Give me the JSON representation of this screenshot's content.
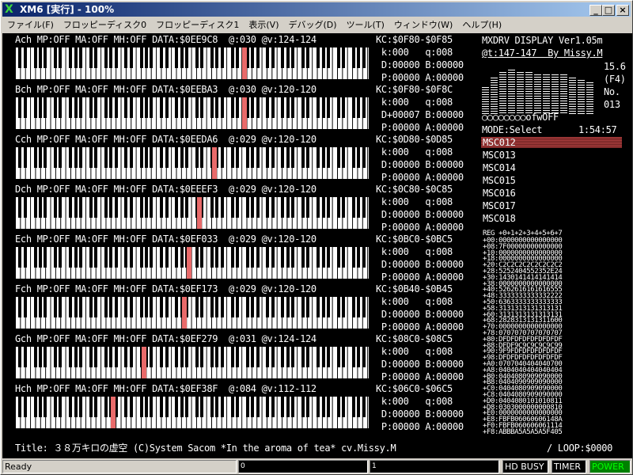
{
  "window": {
    "title": "XM6 [実行] - 100%",
    "app_icon": "X",
    "min": "_",
    "max": "□",
    "close": "×"
  },
  "menu": [
    "ファイル(F)",
    "フロッピーディスク0",
    "フロッピーディスク1",
    "表示(V)",
    "デバッグ(D)",
    "ツール(T)",
    "ウィンドウ(W)",
    "ヘルプ(H)"
  ],
  "channels": [
    {
      "header": "Ach MP:OFF MA:OFF MH:OFF DATA:$0EE9C8  @:030 @v:124-124",
      "kc": "KC:$0F80-$0F85",
      "kq": " k:000   q:008",
      "db": " D:00000 B:00000",
      "pa": " P:00000 A:00000",
      "hit_key": 45
    },
    {
      "header": "Bch MP:OFF MA:OFF MH:OFF DATA:$0EEBA3  @:030 @v:120-120",
      "kc": "KC:$0F80-$0F8C",
      "kq": " k:000   q:008",
      "db": " D+00007 B:00000",
      "pa": " P:00000 A:00000",
      "hit_key": 45
    },
    {
      "header": "Cch MP:OFF MA:OFF MH:OFF DATA:$0EEDA6  @:029 @v:120-120",
      "kc": "KC:$0D80-$0D85",
      "kq": " k:000   q:008",
      "db": " D:00000 B:00000",
      "pa": " P:00000 A:00000",
      "hit_key": 39
    },
    {
      "header": "Dch MP:OFF MA:OFF MH:OFF DATA:$0EEEF3  @:029 @v:120-120",
      "kc": "KC:$0C80-$0C85",
      "kq": " k:000   q:008",
      "db": " D:00000 B:00000",
      "pa": " P:00000 A:00000",
      "hit_key": 36
    },
    {
      "header": "Ech MP:OFF MA:OFF MH:OFF DATA:$0EF033  @:029 @v:120-120",
      "kc": "KC:$0BC0-$0BC5",
      "kq": " k:000   q:008",
      "db": " D:00000 B:00000",
      "pa": " P:00000 A:00000",
      "hit_key": 34
    },
    {
      "header": "Fch MP:OFF MA:OFF MH:OFF DATA:$0EF173  @:029 @v:120-120",
      "kc": "KC:$0B40-$0B45",
      "kq": " k:000   q:008",
      "db": " D:00000 B:00000",
      "pa": " P:00000 A:00000",
      "hit_key": 33
    },
    {
      "header": "Gch MP:OFF MA:OFF MH:OFF DATA:$0EF279  @:031 @v:124-124",
      "kc": "KC:$08C0-$08C5",
      "kq": " k:000   q:008",
      "db": " D:00000 B:00000",
      "pa": " P:00000 A:00000",
      "hit_key": 25
    },
    {
      "header": "Hch MP:OFF MA:OFF MH:OFF DATA:$0EF38F  @:084 @v:112-112",
      "kc": "KC:$06C0-$06C5",
      "kq": " k:000   q:008",
      "db": " D:00000 B:00000",
      "pa": " P:00000 A:00000",
      "hit_key": 19
    }
  ],
  "display": {
    "title": "MXDRV DISPLAY Ver1.05m",
    "tempo": "@t:147-147  By Missy.M",
    "value": "15.6",
    "fkey": "(F4)",
    "no_label": "No.",
    "no_value": "013",
    "indicators": "○○○○○○○○ofwOFF",
    "mode": "MODE:Select",
    "time": "1:54:57",
    "vu_levels": [
      0.55,
      0.75,
      0.85,
      0.9,
      0.85,
      0.85,
      0.8,
      0.8,
      0.8,
      0.8,
      0.75,
      0.7,
      0.65
    ],
    "files": [
      "MSC012",
      "MSC013",
      "MSC014",
      "MSC015",
      "MSC016",
      "MSC017",
      "MSC018"
    ],
    "selected_index": 0
  },
  "registers": {
    "header": "REG +0+1+2+3+4+5+6+7",
    "rows": [
      "+00:0000000000000000",
      "+08:7F00000000000000",
      "+10:0000000000000000",
      "+18:0000000000000000",
      "+20:C2C2C2C2C2C2C2C2",
      "+28:5252404552352E24",
      "+30:1430141414141414",
      "+38:0000000000000000",
      "+40:5262616161616555",
      "+48:3333333333332222",
      "+50:6363333333333333",
      "+58:3131313131313131",
      "+60:3131313131313131",
      "+68:2828313131311600",
      "+70:0000000000000000",
      "+78:0707070707070707",
      "+80:DFDFDFDFDFDFDFDF",
      "+88:DFDF9C9C9C9C9C99",
      "+90:9F9FDFDFDFDFDFDF",
      "+98:DFDFDFDFDFDFDFDF",
      "+A0:0707040404040700",
      "+A8:0404040404040404",
      "+B0:0404080909090000",
      "+B8:0404090909090000",
      "+C0:0404080909090000",
      "+C8:0404080909090000",
      "+D0:0404080101010811",
      "+D8:0303000000000810",
      "+E0:0000000000000000",
      "+E8:FBFB06060606148A",
      "+F0:FBFB060606061114",
      "+F8:ABBBA5A5A5A5F405"
    ]
  },
  "footer": {
    "title_line": "Title: ３８万キロの虚空 (C)System Sacom *In the aroma of tea* cv.Missy.M",
    "loop": "/ LOOP:$0000"
  },
  "status": {
    "ready": "Ready",
    "fdd0": "0",
    "fdd1": "1",
    "hd": "HD BUSY",
    "timer": "TIMER",
    "power": "POWER"
  }
}
